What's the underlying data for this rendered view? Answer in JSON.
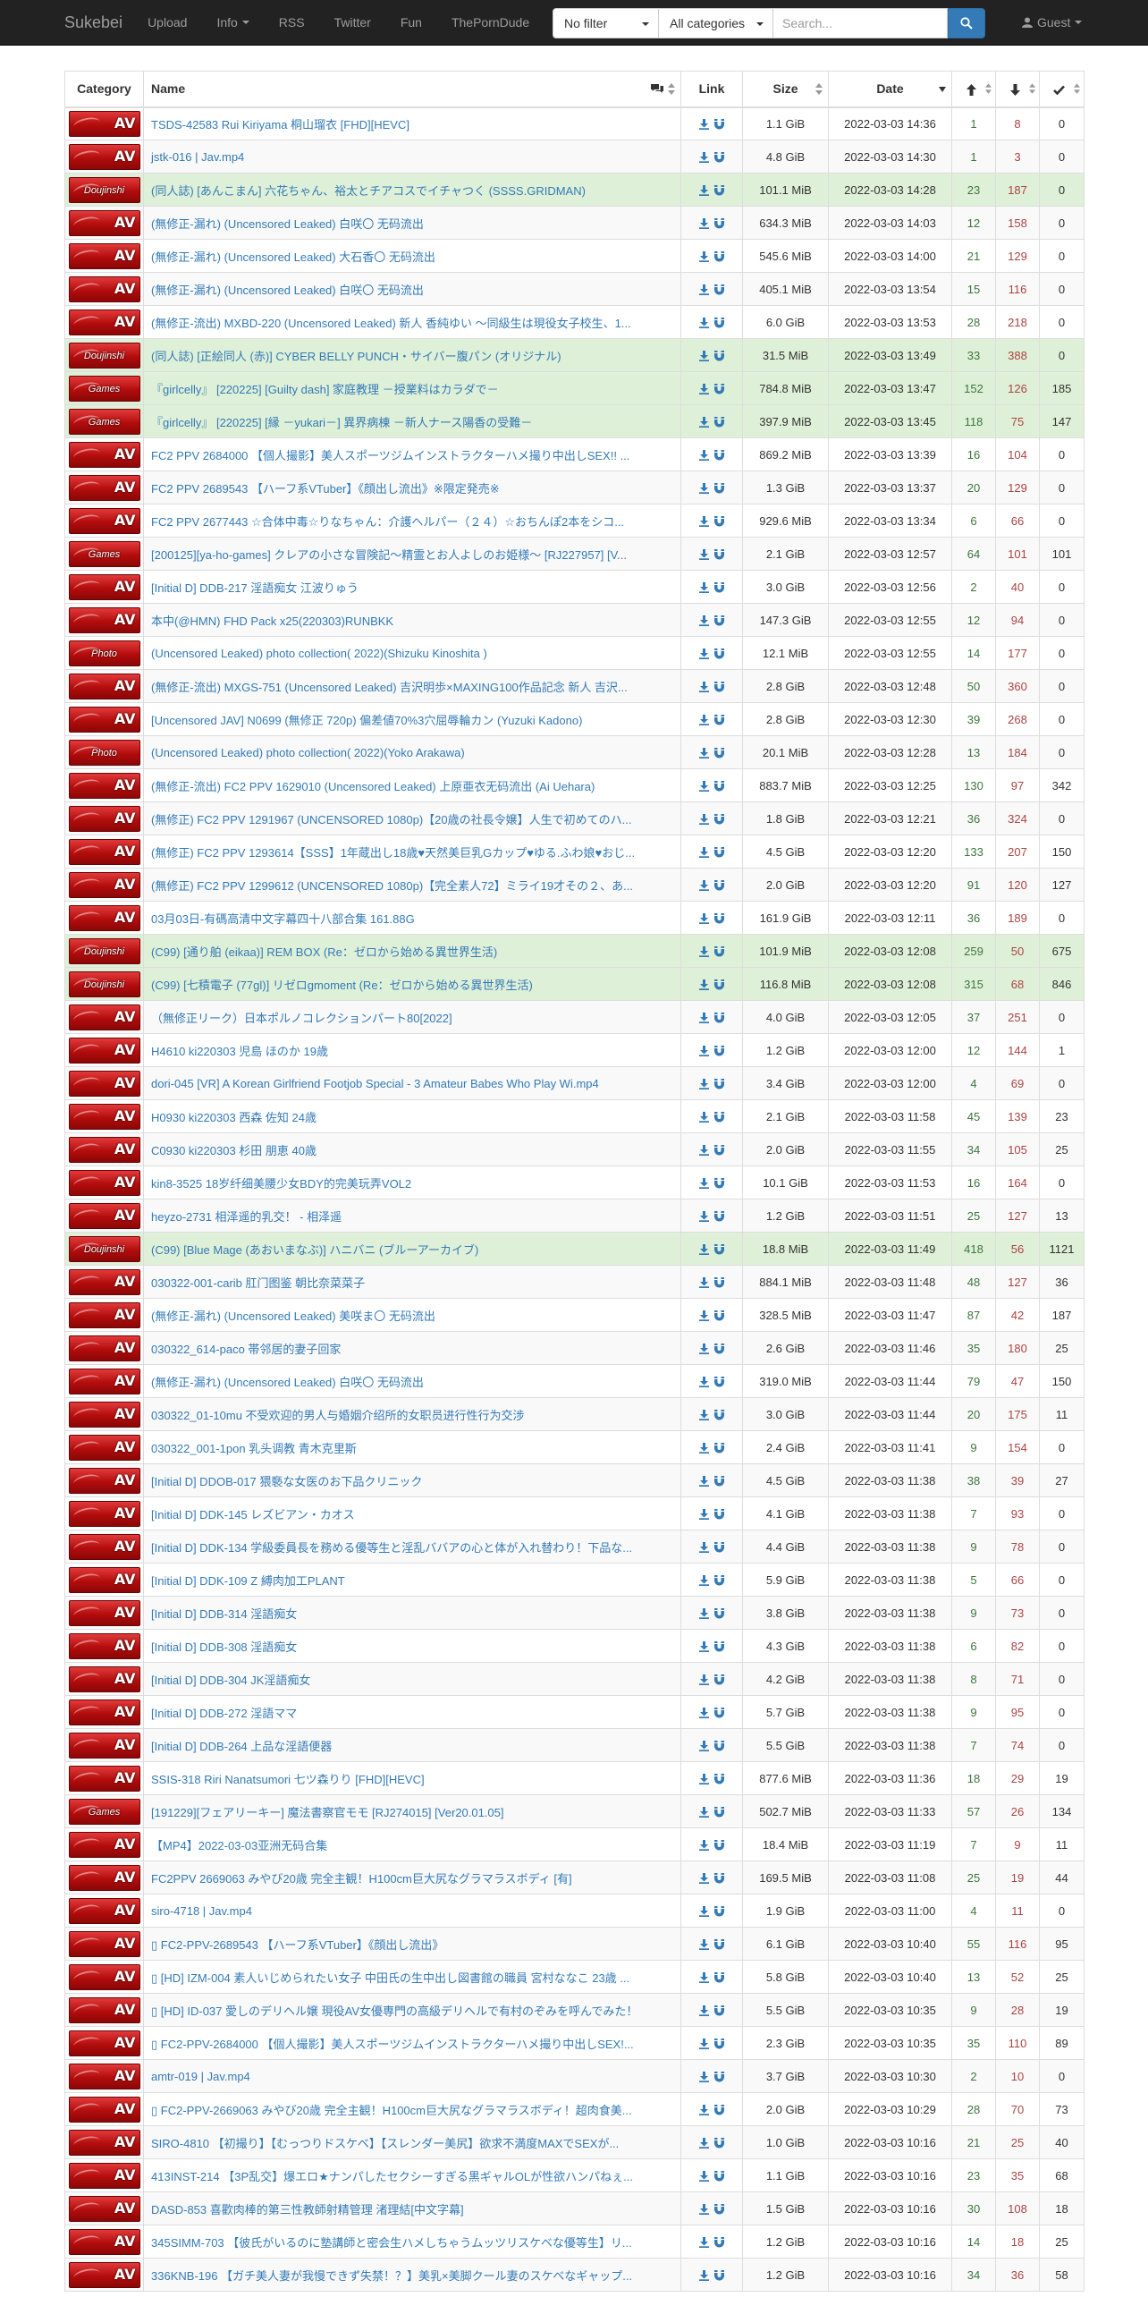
{
  "navbar": {
    "brand": "Sukebei",
    "upload": "Upload",
    "info": "Info",
    "rss": "RSS",
    "twitter": "Twitter",
    "fun": "Fun",
    "theporndude": "ThePornDude",
    "filter_selected": "No filter",
    "category_selected": "All categories",
    "search_placeholder": "Search...",
    "guest": "Guest"
  },
  "table": {
    "headers": {
      "category": "Category",
      "name": "Name",
      "link": "Link",
      "size": "Size",
      "date": "Date"
    },
    "rows": [
      {
        "cat": "AV",
        "title": "TSDS-42583 Rui Kiriyama 桐山瑠衣 [FHD][HEVC]",
        "size": "1.1 GiB",
        "date": "2022-03-03 14:36",
        "seeders": "1",
        "leechers": "8",
        "completed": "0",
        "style": "default"
      },
      {
        "cat": "AV",
        "title": "jstk-016 | Jav.mp4",
        "size": "4.8 GiB",
        "date": "2022-03-03 14:30",
        "seeders": "1",
        "leechers": "3",
        "completed": "0",
        "style": "default"
      },
      {
        "cat": "Doujinshi",
        "title": "(同人誌) [あんこまん] 六花ちゃん、裕太とチアコスでイチャつく (SSSS.GRIDMAN)",
        "size": "101.1 MiB",
        "date": "2022-03-03 14:28",
        "seeders": "23",
        "leechers": "187",
        "completed": "0",
        "style": "success"
      },
      {
        "cat": "AV",
        "title": "(無修正-漏れ) (Uncensored Leaked) 白咲〇 无码流出",
        "size": "634.3 MiB",
        "date": "2022-03-03 14:03",
        "seeders": "12",
        "leechers": "158",
        "completed": "0",
        "style": "default"
      },
      {
        "cat": "AV",
        "title": "(無修正-漏れ) (Uncensored Leaked) 大石香〇 无码流出",
        "size": "545.6 MiB",
        "date": "2022-03-03 14:00",
        "seeders": "21",
        "leechers": "129",
        "completed": "0",
        "style": "default"
      },
      {
        "cat": "AV",
        "title": "(無修正-漏れ) (Uncensored Leaked) 白咲〇 无码流出",
        "size": "405.1 MiB",
        "date": "2022-03-03 13:54",
        "seeders": "15",
        "leechers": "116",
        "completed": "0",
        "style": "default"
      },
      {
        "cat": "AV",
        "title": "(無修正-流出) MXBD-220 (Uncensored Leaked) 新人 香純ゆい ～同級生は現役女子校生、1...",
        "size": "6.0 GiB",
        "date": "2022-03-03 13:53",
        "seeders": "28",
        "leechers": "218",
        "completed": "0",
        "style": "default"
      },
      {
        "cat": "Doujinshi",
        "title": "(同人誌) [正絵同人 (赤)] CYBER BELLY PUNCH・サイバー腹パン (オリジナル)",
        "size": "31.5 MiB",
        "date": "2022-03-03 13:49",
        "seeders": "33",
        "leechers": "388",
        "completed": "0",
        "style": "success"
      },
      {
        "cat": "Games",
        "title": "『girlcelly』 [220225] [Guilty dash] 家庭教理 －授業料はカラダで－",
        "size": "784.8 MiB",
        "date": "2022-03-03 13:47",
        "seeders": "152",
        "leechers": "126",
        "completed": "185",
        "style": "success"
      },
      {
        "cat": "Games",
        "title": "『girlcelly』 [220225] [縁 －yukari－] 異界病棟 －新人ナース陽香の受難－",
        "size": "397.9 MiB",
        "date": "2022-03-03 13:45",
        "seeders": "118",
        "leechers": "75",
        "completed": "147",
        "style": "success"
      },
      {
        "cat": "AV",
        "title": "FC2 PPV 2684000 【個人撮影】美人スポーツジムインストラクターハメ撮り中出しSEX!! ...",
        "size": "869.2 MiB",
        "date": "2022-03-03 13:39",
        "seeders": "16",
        "leechers": "104",
        "completed": "0",
        "style": "default"
      },
      {
        "cat": "AV",
        "title": "FC2 PPV 2689543 【ハーフ系VTuber】《顔出し流出》※限定発売※",
        "size": "1.3 GiB",
        "date": "2022-03-03 13:37",
        "seeders": "20",
        "leechers": "129",
        "completed": "0",
        "style": "default"
      },
      {
        "cat": "AV",
        "title": "FC2 PPV 2677443 ☆合体中毒☆りなちゃん：介護ヘルパー（２４）☆おちんぽ2本をシコ...",
        "size": "929.6 MiB",
        "date": "2022-03-03 13:34",
        "seeders": "6",
        "leechers": "66",
        "completed": "0",
        "style": "default"
      },
      {
        "cat": "Games",
        "title": "[200125][ya-ho-games] クレアの小さな冒険記～精霊とお人よしのお姫様～ [RJ227957] [V...",
        "size": "2.1 GiB",
        "date": "2022-03-03 12:57",
        "seeders": "64",
        "leechers": "101",
        "completed": "101",
        "style": "default"
      },
      {
        "cat": "AV",
        "title": "[Initial D] DDB-217 淫語痴女 江波りゅう",
        "size": "3.0 GiB",
        "date": "2022-03-03 12:56",
        "seeders": "2",
        "leechers": "40",
        "completed": "0",
        "style": "default"
      },
      {
        "cat": "AV",
        "title": "本中(@HMN) FHD Pack x25(220303)RUNBKK",
        "size": "147.3 GiB",
        "date": "2022-03-03 12:55",
        "seeders": "12",
        "leechers": "94",
        "completed": "0",
        "style": "default"
      },
      {
        "cat": "Photo",
        "title": "(Uncensored Leaked) photo collection( 2022)(Shizuku Kinoshita )",
        "size": "12.1 MiB",
        "date": "2022-03-03 12:55",
        "seeders": "14",
        "leechers": "177",
        "completed": "0",
        "style": "default"
      },
      {
        "cat": "AV",
        "title": "(無修正-流出) MXGS-751 (Uncensored Leaked) 吉沢明歩×MAXING100作品記念 新人 吉沢...",
        "size": "2.8 GiB",
        "date": "2022-03-03 12:48",
        "seeders": "50",
        "leechers": "360",
        "completed": "0",
        "style": "default"
      },
      {
        "cat": "AV",
        "title": "[Uncensored JAV] N0699 (無修正 720p) 偏差値70%3穴屈辱輪カン (Yuzuki Kadono)",
        "size": "2.8 GiB",
        "date": "2022-03-03 12:30",
        "seeders": "39",
        "leechers": "268",
        "completed": "0",
        "style": "default"
      },
      {
        "cat": "Photo",
        "title": "(Uncensored Leaked) photo collection( 2022)(Yoko Arakawa)",
        "size": "20.1 MiB",
        "date": "2022-03-03 12:28",
        "seeders": "13",
        "leechers": "184",
        "completed": "0",
        "style": "default"
      },
      {
        "cat": "AV",
        "title": "(無修正-流出) FC2 PPV 1629010 (Uncensored Leaked) 上原亜衣无码流出 (Ai Uehara)",
        "size": "883.7 MiB",
        "date": "2022-03-03 12:25",
        "seeders": "130",
        "leechers": "97",
        "completed": "342",
        "style": "default"
      },
      {
        "cat": "AV",
        "title": "(無修正) FC2 PPV 1291967 (UNCENSORED 1080p)【20歳の社長令嬢】人生で初めてのハ...",
        "size": "1.8 GiB",
        "date": "2022-03-03 12:21",
        "seeders": "36",
        "leechers": "324",
        "completed": "0",
        "style": "default"
      },
      {
        "cat": "AV",
        "title": "(無修正) FC2 PPV 1293614【SSS】1年蔵出し18歳♥天然美巨乳Gカップ♥ゆる.ふわ娘♥おじ...",
        "size": "4.5 GiB",
        "date": "2022-03-03 12:20",
        "seeders": "133",
        "leechers": "207",
        "completed": "150",
        "style": "default"
      },
      {
        "cat": "AV",
        "title": "(無修正) FC2 PPV 1299612 (UNCENSORED 1080p)【完全素人72】ミライ19才その２、あ...",
        "size": "2.0 GiB",
        "date": "2022-03-03 12:20",
        "seeders": "91",
        "leechers": "120",
        "completed": "127",
        "style": "default"
      },
      {
        "cat": "AV",
        "title": "03月03日-有碼高清中文字幕四十八部合集 161.88G",
        "size": "161.9 GiB",
        "date": "2022-03-03 12:11",
        "seeders": "36",
        "leechers": "189",
        "completed": "0",
        "style": "default"
      },
      {
        "cat": "Doujinshi",
        "title": "(C99) [通り舶 (eikaa)] REM BOX (Re：ゼロから始める異世界生活)",
        "size": "101.9 MiB",
        "date": "2022-03-03 12:08",
        "seeders": "259",
        "leechers": "50",
        "completed": "675",
        "style": "success"
      },
      {
        "cat": "Doujinshi",
        "title": "(C99) [七積電子 (77gl)] リゼロgmoment (Re：ゼロから始める異世界生活)",
        "size": "116.8 MiB",
        "date": "2022-03-03 12:08",
        "seeders": "315",
        "leechers": "68",
        "completed": "846",
        "style": "success"
      },
      {
        "cat": "AV",
        "title": "（無修正リーク）日本ポルノコレクションパート80[2022]",
        "size": "4.0 GiB",
        "date": "2022-03-03 12:05",
        "seeders": "37",
        "leechers": "251",
        "completed": "0",
        "style": "default"
      },
      {
        "cat": "AV",
        "title": "H4610 ki220303 児島 ほのか 19歳",
        "size": "1.2 GiB",
        "date": "2022-03-03 12:00",
        "seeders": "12",
        "leechers": "144",
        "completed": "1",
        "style": "default"
      },
      {
        "cat": "AV",
        "title": "dori-045 [VR] A Korean Girlfriend Footjob Special - 3 Amateur Babes Who Play Wi.mp4",
        "size": "3.4 GiB",
        "date": "2022-03-03 12:00",
        "seeders": "4",
        "leechers": "69",
        "completed": "0",
        "style": "default"
      },
      {
        "cat": "AV",
        "title": "H0930 ki220303 西森 佐知 24歳",
        "size": "2.1 GiB",
        "date": "2022-03-03 11:58",
        "seeders": "45",
        "leechers": "139",
        "completed": "23",
        "style": "default"
      },
      {
        "cat": "AV",
        "title": "C0930 ki220303 杉田 朋恵 40歳",
        "size": "2.0 GiB",
        "date": "2022-03-03 11:55",
        "seeders": "34",
        "leechers": "105",
        "completed": "25",
        "style": "default"
      },
      {
        "cat": "AV",
        "title": "kin8-3525 18岁纤细美腰少女BDY的完美玩弄VOL2",
        "size": "10.1 GiB",
        "date": "2022-03-03 11:53",
        "seeders": "16",
        "leechers": "164",
        "completed": "0",
        "style": "default"
      },
      {
        "cat": "AV",
        "title": "heyzo-2731 相泽遥的乳交！ - 相泽遥",
        "size": "1.2 GiB",
        "date": "2022-03-03 11:51",
        "seeders": "25",
        "leechers": "127",
        "completed": "13",
        "style": "default"
      },
      {
        "cat": "Doujinshi",
        "title": "(C99) [Blue Mage (あおいまなぶ)] ハニバニ (ブルーアーカイブ)",
        "size": "18.8 MiB",
        "date": "2022-03-03 11:49",
        "seeders": "418",
        "leechers": "56",
        "completed": "1121",
        "style": "success"
      },
      {
        "cat": "AV",
        "title": "030322-001-carib 肛门图鉴 朝比奈菜菜子",
        "size": "884.1 MiB",
        "date": "2022-03-03 11:48",
        "seeders": "48",
        "leechers": "127",
        "completed": "36",
        "style": "default"
      },
      {
        "cat": "AV",
        "title": "(無修正-漏れ) (Uncensored Leaked) 美咲ま〇 无码流出",
        "size": "328.5 MiB",
        "date": "2022-03-03 11:47",
        "seeders": "87",
        "leechers": "42",
        "completed": "187",
        "style": "default"
      },
      {
        "cat": "AV",
        "title": "030322_614-paco 帯邻居的妻子回家",
        "size": "2.6 GiB",
        "date": "2022-03-03 11:46",
        "seeders": "35",
        "leechers": "180",
        "completed": "25",
        "style": "default"
      },
      {
        "cat": "AV",
        "title": "(無修正-漏れ) (Uncensored Leaked) 白咲〇 无码流出",
        "size": "319.0 MiB",
        "date": "2022-03-03 11:44",
        "seeders": "79",
        "leechers": "47",
        "completed": "150",
        "style": "default"
      },
      {
        "cat": "AV",
        "title": "030322_01-10mu 不受欢迎的男人与婚姻介绍所的女职员进行性行为交涉",
        "size": "3.0 GiB",
        "date": "2022-03-03 11:44",
        "seeders": "20",
        "leechers": "175",
        "completed": "11",
        "style": "default"
      },
      {
        "cat": "AV",
        "title": "030322_001-1pon 乳头调教 青木克里斯",
        "size": "2.4 GiB",
        "date": "2022-03-03 11:41",
        "seeders": "9",
        "leechers": "154",
        "completed": "0",
        "style": "default"
      },
      {
        "cat": "AV",
        "title": "[Initial D] DDOB-017 猥褻な女医のお下品クリニック",
        "size": "4.5 GiB",
        "date": "2022-03-03 11:38",
        "seeders": "38",
        "leechers": "39",
        "completed": "27",
        "style": "default"
      },
      {
        "cat": "AV",
        "title": "[Initial D] DDK-145 レズビアン・カオス",
        "size": "4.1 GiB",
        "date": "2022-03-03 11:38",
        "seeders": "7",
        "leechers": "93",
        "completed": "0",
        "style": "default"
      },
      {
        "cat": "AV",
        "title": "[Initial D] DDK-134 学級委員長を務める優等生と淫乱ババアの心と体が入れ替わり！下品な...",
        "size": "4.4 GiB",
        "date": "2022-03-03 11:38",
        "seeders": "9",
        "leechers": "78",
        "completed": "0",
        "style": "default"
      },
      {
        "cat": "AV",
        "title": "[Initial D] DDK-109 Z 縛肉加工PLANT",
        "size": "5.9 GiB",
        "date": "2022-03-03 11:38",
        "seeders": "5",
        "leechers": "66",
        "completed": "0",
        "style": "default"
      },
      {
        "cat": "AV",
        "title": "[Initial D] DDB-314 淫語痴女",
        "size": "3.8 GiB",
        "date": "2022-03-03 11:38",
        "seeders": "9",
        "leechers": "73",
        "completed": "0",
        "style": "default"
      },
      {
        "cat": "AV",
        "title": "[Initial D] DDB-308 淫語痴女",
        "size": "4.3 GiB",
        "date": "2022-03-03 11:38",
        "seeders": "6",
        "leechers": "82",
        "completed": "0",
        "style": "default"
      },
      {
        "cat": "AV",
        "title": "[Initial D] DDB-304 JK淫語痴女",
        "size": "4.2 GiB",
        "date": "2022-03-03 11:38",
        "seeders": "8",
        "leechers": "71",
        "completed": "0",
        "style": "default"
      },
      {
        "cat": "AV",
        "title": "[Initial D] DDB-272 淫語ママ",
        "size": "5.7 GiB",
        "date": "2022-03-03 11:38",
        "seeders": "9",
        "leechers": "95",
        "completed": "0",
        "style": "default"
      },
      {
        "cat": "AV",
        "title": "[Initial D] DDB-264 上品な淫語便器",
        "size": "5.5 GiB",
        "date": "2022-03-03 11:38",
        "seeders": "7",
        "leechers": "74",
        "completed": "0",
        "style": "default"
      },
      {
        "cat": "AV",
        "title": "SSIS-318 Riri Nanatsumori 七ツ森りり [FHD][HEVC]",
        "size": "877.6 MiB",
        "date": "2022-03-03 11:36",
        "seeders": "18",
        "leechers": "29",
        "completed": "19",
        "style": "default"
      },
      {
        "cat": "Games",
        "title": "[191229][フェアリーキー] 魔法書察官モモ [RJ274015] [Ver20.01.05]",
        "size": "502.7 MiB",
        "date": "2022-03-03 11:33",
        "seeders": "57",
        "leechers": "26",
        "completed": "134",
        "style": "default"
      },
      {
        "cat": "AV",
        "title": "【MP4】2022-03-03亚洲无码合集",
        "size": "18.4 MiB",
        "date": "2022-03-03 11:19",
        "seeders": "7",
        "leechers": "9",
        "completed": "11",
        "style": "default"
      },
      {
        "cat": "AV",
        "title": "FC2PPV 2669063 みやび20歳 完全主観！H100cm巨大尻なグラマラスボディ [有]",
        "size": "169.5 MiB",
        "date": "2022-03-03 11:08",
        "seeders": "25",
        "leechers": "19",
        "completed": "44",
        "style": "default"
      },
      {
        "cat": "AV",
        "title": "siro-4718 | Jav.mp4",
        "size": "1.9 GiB",
        "date": "2022-03-03 11:00",
        "seeders": "4",
        "leechers": "11",
        "completed": "0",
        "style": "default"
      },
      {
        "cat": "AV",
        "title": "▯ FC2-PPV-2689543 【ハーフ系VTuber】《顔出し流出》",
        "size": "6.1 GiB",
        "date": "2022-03-03 10:40",
        "seeders": "55",
        "leechers": "116",
        "completed": "95",
        "style": "default"
      },
      {
        "cat": "AV",
        "title": "▯ [HD] IZM-004 素人いじめられたい女子 中田氏の生中出し図書館の職員 宮村ななこ 23歳 ...",
        "size": "5.8 GiB",
        "date": "2022-03-03 10:40",
        "seeders": "13",
        "leechers": "52",
        "completed": "25",
        "style": "default"
      },
      {
        "cat": "AV",
        "title": "▯ [HD] ID-037 愛しのデリヘル嬢 現役AV女優専門の高級デリヘルで有村のぞみを呼んでみた！",
        "size": "5.5 GiB",
        "date": "2022-03-03 10:35",
        "seeders": "9",
        "leechers": "28",
        "completed": "19",
        "style": "default"
      },
      {
        "cat": "AV",
        "title": "▯ FC2-PPV-2684000 【個人撮影】美人スポーツジムインストラクターハメ撮り中出しSEX!...",
        "size": "2.3 GiB",
        "date": "2022-03-03 10:35",
        "seeders": "35",
        "leechers": "110",
        "completed": "89",
        "style": "default"
      },
      {
        "cat": "AV",
        "title": "amtr-019 | Jav.mp4",
        "size": "3.7 GiB",
        "date": "2022-03-03 10:30",
        "seeders": "2",
        "leechers": "10",
        "completed": "0",
        "style": "default"
      },
      {
        "cat": "AV",
        "title": "▯ FC2-PPV-2669063 みやび20歳 完全主観！H100cm巨大尻なグラマラスボディ！超肉食美...",
        "size": "2.0 GiB",
        "date": "2022-03-03 10:29",
        "seeders": "28",
        "leechers": "70",
        "completed": "73",
        "style": "default"
      },
      {
        "cat": "AV",
        "title": "SIRO-4810 【初撮り】【むっつりドスケベ】【スレンダー美尻】欲求不満度MAXでSEXが...",
        "size": "1.0 GiB",
        "date": "2022-03-03 10:16",
        "seeders": "21",
        "leechers": "25",
        "completed": "40",
        "style": "default"
      },
      {
        "cat": "AV",
        "title": "413INST-214 【3P乱交】爆エロ★ナンパしたセクシーすぎる黒ギャルOLが性欲ハンパねぇ...",
        "size": "1.1 GiB",
        "date": "2022-03-03 10:16",
        "seeders": "23",
        "leechers": "35",
        "completed": "68",
        "style": "default"
      },
      {
        "cat": "AV",
        "title": "DASD-853 喜歡肉棒的第三性教師射精管理 渚理結[中文字幕]",
        "size": "1.5 GiB",
        "date": "2022-03-03 10:16",
        "seeders": "30",
        "leechers": "108",
        "completed": "18",
        "style": "default"
      },
      {
        "cat": "AV",
        "title": "345SIMM-703 【彼氏がいるのに塾講師と密会生ハメしちゃうムッツリスケベな優等生】リ...",
        "size": "1.2 GiB",
        "date": "2022-03-03 10:16",
        "seeders": "14",
        "leechers": "18",
        "completed": "25",
        "style": "default"
      },
      {
        "cat": "AV",
        "title": "336KNB-196 【ガチ美人妻が我慢できず失禁！？】美乳×美脚クール妻のスケベなギャップ...",
        "size": "1.2 GiB",
        "date": "2022-03-03 10:16",
        "seeders": "34",
        "leechers": "36",
        "completed": "58",
        "style": "default"
      }
    ]
  },
  "colors": {
    "navbar_bg": "#222222",
    "link": "#337ab7",
    "seeders": "#3c763d",
    "leechers": "#a94442",
    "success_row": "#dff0d8",
    "badge_red": "#c41a1a"
  },
  "icons": [
    "comments-icon",
    "sort-icon",
    "download-icon",
    "magnet-icon",
    "arrow-up-icon",
    "arrow-down-icon",
    "check-icon",
    "search-icon",
    "user-icon"
  ]
}
